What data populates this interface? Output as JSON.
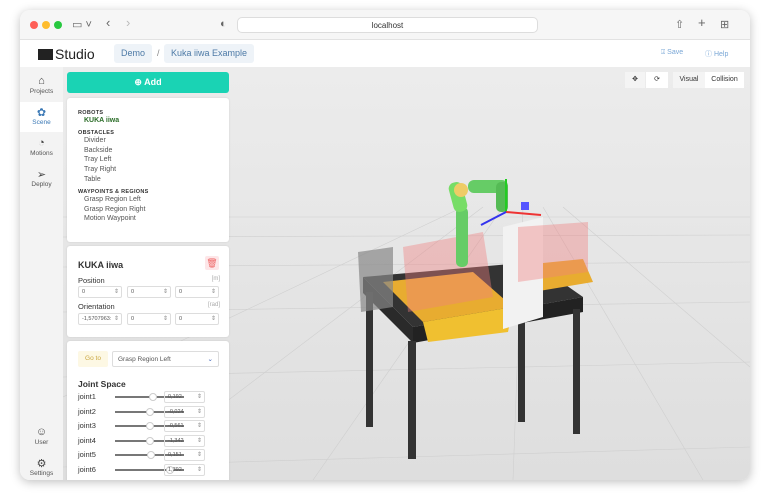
{
  "browser": {
    "url": "localhost"
  },
  "header": {
    "logo": "Studio",
    "breadcrumbs": [
      "Demo",
      "Kuka iiwa Example"
    ],
    "save": "Save",
    "help": "Help"
  },
  "nav": [
    {
      "label": "Projects",
      "icon": "home-icon"
    },
    {
      "label": "Scene",
      "icon": "scene-icon"
    },
    {
      "label": "Motions",
      "icon": "motions-icon"
    },
    {
      "label": "Deploy",
      "icon": "deploy-icon"
    },
    {
      "label": "User",
      "icon": "user-icon"
    },
    {
      "label": "Settings",
      "icon": "settings-icon"
    }
  ],
  "add_label": "Add",
  "tree": {
    "robots_title": "ROBOTS",
    "robots": [
      "KUKA iiwa"
    ],
    "obstacles_title": "OBSTACLES",
    "obstacles": [
      "Divider",
      "Backside",
      "Tray Left",
      "Tray Right",
      "Table"
    ],
    "waypoints_title": "WAYPOINTS & REGIONS",
    "waypoints": [
      "Grasp Region Left",
      "Grasp Region Right",
      "Motion Waypoint"
    ]
  },
  "robot_panel": {
    "title": "KUKA iiwa",
    "position_label": "Position",
    "position_unit": "[m]",
    "position": [
      "0",
      "0",
      "0"
    ],
    "orientation_label": "Orientation",
    "orientation_unit": "[rad]",
    "orientation": [
      "-1,5707963:",
      "0",
      "0"
    ]
  },
  "motion_panel": {
    "goto_label": "Go to",
    "goto_value": "Grasp Region Left",
    "joint_title": "Joint Space",
    "joints": [
      {
        "name": "joint1",
        "value": "0,192",
        "slider": 0.55
      },
      {
        "name": "joint2",
        "value": "-0,024",
        "slider": 0.5
      },
      {
        "name": "joint3",
        "value": "-0,561",
        "slider": 0.5
      },
      {
        "name": "joint4",
        "value": "-1,342",
        "slider": 0.5
      },
      {
        "name": "joint5",
        "value": "0,151",
        "slider": 0.52
      },
      {
        "name": "joint6",
        "value": "1,392",
        "slider": 0.8
      }
    ]
  },
  "viewport": {
    "visual": "Visual",
    "collision": "Collision"
  },
  "colors": {
    "accent": "#1ad3b4",
    "link": "#4d7aa6"
  }
}
